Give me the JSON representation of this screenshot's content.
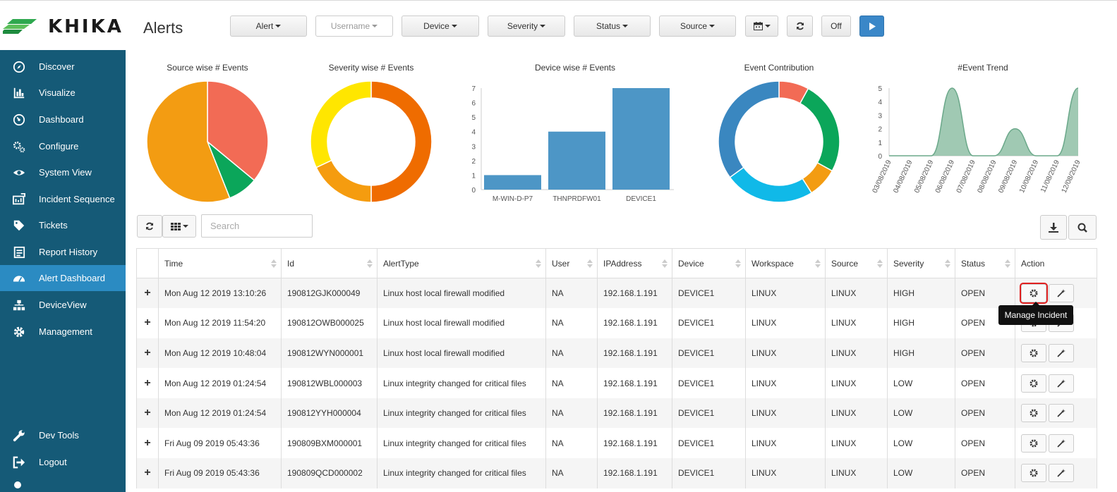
{
  "header": {
    "logo_text": "KHIKA",
    "title": "Alerts",
    "filters": [
      {
        "label": "Alert",
        "dim": false
      },
      {
        "label": "Username",
        "dim": true
      },
      {
        "label": "Device",
        "dim": false
      },
      {
        "label": "Severity",
        "dim": false
      },
      {
        "label": "Status",
        "dim": false
      },
      {
        "label": "Source",
        "dim": false
      }
    ],
    "calendar_icon": "calendar-icon",
    "refresh_icon": "refresh-icon",
    "auto_refresh_label": "Off",
    "play_icon": "play-icon",
    "accent_color": "#3a87c8"
  },
  "sidebar": {
    "background": "#155a77",
    "items": [
      {
        "label": "Discover",
        "icon": "compass-icon",
        "active": false
      },
      {
        "label": "Visualize",
        "icon": "bar-chart-icon",
        "active": false
      },
      {
        "label": "Dashboard",
        "icon": "gauge-icon",
        "active": false
      },
      {
        "label": "Configure",
        "icon": "gears-icon",
        "active": false
      },
      {
        "label": "System View",
        "icon": "eye-icon",
        "active": false
      },
      {
        "label": "Incident Sequence",
        "icon": "sequence-icon",
        "active": false
      },
      {
        "label": "Tickets",
        "icon": "tag-icon",
        "active": false
      },
      {
        "label": "Report History",
        "icon": "report-icon",
        "active": false
      },
      {
        "label": "Alert Dashboard",
        "icon": "dashboard-icon",
        "active": true
      },
      {
        "label": "DeviceView",
        "icon": "sitemap-icon",
        "active": false
      },
      {
        "label": "Management",
        "icon": "gear-icon",
        "active": false
      },
      {
        "label": "Dev Tools",
        "icon": "wrench-icon",
        "active": false
      },
      {
        "label": "Logout",
        "icon": "logout-icon",
        "active": false
      }
    ]
  },
  "charts": {
    "source_pie_title": "Source wise # Events",
    "severity_donut_title": "Severity wise # Events",
    "device_bar_title": "Device wise # Events",
    "contribution_title": "Event Contribution",
    "trend_title": "#Event Trend"
  },
  "chart_data": [
    {
      "type": "pie",
      "title": "Source wise # Events",
      "values": [
        36,
        8,
        56
      ],
      "colors": [
        "#f26b55",
        "#0ba65a",
        "#f39c12"
      ]
    },
    {
      "type": "pie",
      "title": "Severity wise # Events",
      "donut": true,
      "values": [
        50,
        18,
        32
      ],
      "colors": [
        "#ef6c00",
        "#f59c0f",
        "#ffe600"
      ]
    },
    {
      "type": "bar",
      "title": "Device wise # Events",
      "categories": [
        "M-WIN-D-P7",
        "THNPRDFW01",
        "DEVICE1"
      ],
      "values": [
        1,
        4,
        7
      ],
      "ylim": [
        0,
        7
      ],
      "yticks": [
        0,
        1,
        2,
        3,
        4,
        5,
        6,
        7
      ],
      "color": "#4d96c6"
    },
    {
      "type": "pie",
      "title": "Event Contribution",
      "donut": true,
      "values": [
        8,
        25,
        8,
        24,
        35
      ],
      "colors": [
        "#f26b55",
        "#0ba65a",
        "#f39c12",
        "#10b9e8",
        "#3a87c0"
      ]
    },
    {
      "type": "area",
      "title": "#Event Trend",
      "x": [
        "03/08/2019",
        "04/08/2019",
        "05/08/2019",
        "06/08/2019",
        "07/08/2019",
        "08/08/2019",
        "09/08/2019",
        "10/08/2019",
        "11/08/2019",
        "12/08/2019"
      ],
      "values": [
        0,
        0,
        0,
        5,
        0,
        0,
        2,
        0,
        0,
        5
      ],
      "ylim": [
        0,
        5
      ],
      "yticks": [
        0,
        1,
        2,
        3,
        4,
        5
      ],
      "color": "#8fbfa6"
    }
  ],
  "table": {
    "search_placeholder": "Search",
    "columns": [
      "",
      "Time",
      "Id",
      "AlertType",
      "User",
      "IPAddress",
      "Device",
      "Workspace",
      "Source",
      "Severity",
      "Status",
      "Action"
    ],
    "rows": [
      [
        "Mon Aug 12 2019 13:10:26",
        "190812GJK000049",
        "Linux host local firewall modified",
        "NA",
        "192.168.1.191",
        "DEVICE1",
        "LINUX",
        "LINUX",
        "HIGH",
        "OPEN"
      ],
      [
        "Mon Aug 12 2019 11:54:20",
        "190812OWB000025",
        "Linux host local firewall modified",
        "NA",
        "192.168.1.191",
        "DEVICE1",
        "LINUX",
        "LINUX",
        "HIGH",
        "OPEN"
      ],
      [
        "Mon Aug 12 2019 10:48:04",
        "190812WYN000001",
        "Linux host local firewall modified",
        "NA",
        "192.168.1.191",
        "DEVICE1",
        "LINUX",
        "LINUX",
        "HIGH",
        "OPEN"
      ],
      [
        "Mon Aug 12 2019 01:24:54",
        "190812WBL000003",
        "Linux integrity changed for critical files",
        "NA",
        "192.168.1.191",
        "DEVICE1",
        "LINUX",
        "LINUX",
        "LOW",
        "OPEN"
      ],
      [
        "Mon Aug 12 2019 01:24:54",
        "190812YYH000004",
        "Linux integrity changed for critical files",
        "NA",
        "192.168.1.191",
        "DEVICE1",
        "LINUX",
        "LINUX",
        "LOW",
        "OPEN"
      ],
      [
        "Fri Aug 09 2019 05:43:36",
        "190809BXM000001",
        "Linux integrity changed for critical files",
        "NA",
        "192.168.1.191",
        "DEVICE1",
        "LINUX",
        "LINUX",
        "LOW",
        "OPEN"
      ],
      [
        "Fri Aug 09 2019 05:43:36",
        "190809QCD000002",
        "Linux integrity changed for critical files",
        "NA",
        "192.168.1.191",
        "DEVICE1",
        "LINUX",
        "LINUX",
        "LOW",
        "OPEN"
      ]
    ],
    "tooltip": "Manage Incident"
  }
}
